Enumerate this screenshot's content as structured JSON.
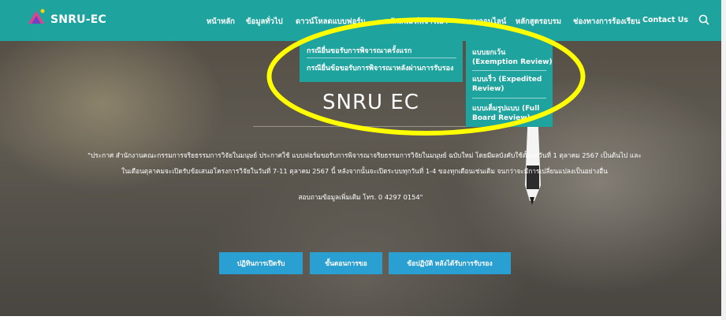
{
  "brand": {
    "name": "SNRU-EC"
  },
  "nav": {
    "items": [
      "หน้าหลัก",
      "ข้อมูลทั่วไป",
      "ดาวน์โหลดแบบฟอร์ม",
      "หลักเกณฑ์พิจารณา",
      "ระบบออนไลน์",
      "หลักสูตรอบรม",
      "ช่องทางการร้องเรียน",
      "Contact Us"
    ]
  },
  "dropdown": {
    "items": [
      "กรณียื่นขอรับการพิจารณาครั้งแรก",
      "กรณียื่นข้อขอรับการพิจารณาหลังผ่านการรับรอง"
    ]
  },
  "submenu": {
    "items": [
      {
        "line1": "แบบยกเว้น",
        "line2": "(Exemption Review)"
      },
      {
        "line1": "แบบเร็ว (Expedited",
        "line2": "Review)"
      },
      {
        "line1": "แบบเต็มรูปแบบ (Full",
        "line2": "Board Review)"
      }
    ]
  },
  "hero": {
    "title": "SNRU EC",
    "notice_line1": "\"ประกาศ สำนักงานคณะกรรมการจริยธรรมการวิจัยในมนุษย์ ประกาศใช้ แบบฟอร์มขอรับการพิจารณาจริยธรรมการวิจัยในมนุษย์ ฉบับใหม่ โดยมีผลบังคับใช้ตั้งแต่วันที่ 1 ตุลาคม 2567 เป็นต้นไป และ",
    "notice_line2": "ในเดือนตุลาคมจะเปิดรับข้อเสนอโครงการวิจัยในวันที่ 7-11 ตุลาคม 2567 นี้ หลังจากนั้นจะเปิดระบบทุกวันที่ 1-4 ของทุกเดือนเช่นเดิม จนกว่าจะมีการเปลี่ยนแปลงเป็นอย่างอื่น",
    "contact": "สอบถามข้อมูลเพิ่มเติม โทร. 0 4297 0154\""
  },
  "buttons": {
    "calendar": "ปฏิทินการเปิดรับ",
    "steps": "ขั้นตอนการขอ",
    "guidelines": "ข้อปฏิบัติ หลังได้รับการรับรอง"
  },
  "colors": {
    "nav_bg": "#1fa39f",
    "button_bg": "#2a9fd1",
    "highlight": "#ffff00"
  },
  "icons": {
    "logo": "snru-logo",
    "search": "search-icon"
  }
}
